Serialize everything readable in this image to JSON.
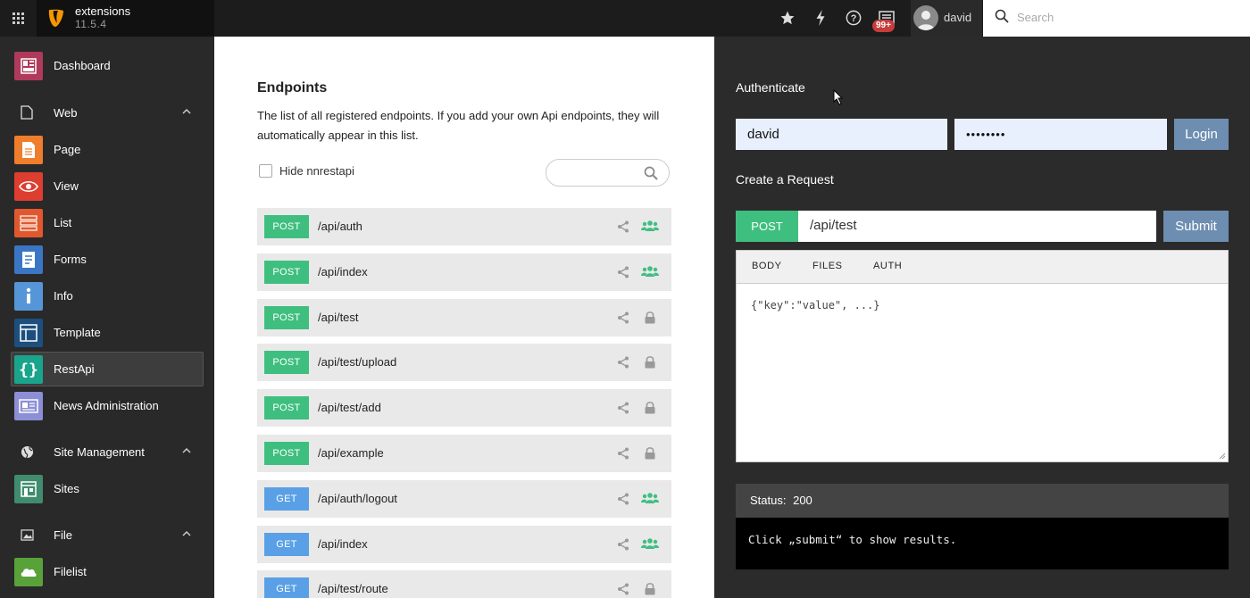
{
  "topbar": {
    "app_name": "extensions",
    "version": "11.5.4",
    "notification_count": "99+",
    "username": "david",
    "search_placeholder": "Search"
  },
  "sidebar": {
    "items": [
      {
        "label": "Dashboard",
        "icon": "dashboard-icon",
        "color": "#b03a5b"
      },
      {
        "label": "Web",
        "icon": "document-icon",
        "group": true
      },
      {
        "label": "Page",
        "icon": "page-icon",
        "color": "#f07d2b"
      },
      {
        "label": "View",
        "icon": "eye-icon",
        "color": "#dd3e30"
      },
      {
        "label": "List",
        "icon": "list-icon",
        "color": "#e2582e"
      },
      {
        "label": "Forms",
        "icon": "forms-icon",
        "color": "#3b76c4"
      },
      {
        "label": "Info",
        "icon": "info-icon",
        "color": "#5696d8"
      },
      {
        "label": "Template",
        "icon": "template-icon",
        "color": "#1c4f7e"
      },
      {
        "label": "RestApi",
        "icon": "braces-icon",
        "color": "#1aa48c"
      },
      {
        "label": "News Administration",
        "icon": "news-icon",
        "color": "#8c8fd6"
      },
      {
        "label": "Site Management",
        "icon": "globe-icon",
        "group": true
      },
      {
        "label": "Sites",
        "icon": "sites-icon",
        "color": "#3f8c6f"
      },
      {
        "label": "File",
        "icon": "image-icon",
        "group": true
      },
      {
        "label": "Filelist",
        "icon": "filelist-icon",
        "color": "#59a23a"
      }
    ]
  },
  "endpoints_panel": {
    "title": "Endpoints",
    "description": "The list of all registered endpoints. If you add your own Api endpoints, they will automatically appear in this list.",
    "hide_label": "Hide nnrestapi",
    "endpoints": [
      {
        "method": "POST",
        "path": "/api/auth",
        "access": "users-icon"
      },
      {
        "method": "POST",
        "path": "/api/index",
        "access": "users-icon"
      },
      {
        "method": "POST",
        "path": "/api/test",
        "access": "lock-icon"
      },
      {
        "method": "POST",
        "path": "/api/test/upload",
        "access": "lock-icon"
      },
      {
        "method": "POST",
        "path": "/api/test/add",
        "access": "lock-icon"
      },
      {
        "method": "POST",
        "path": "/api/example",
        "access": "lock-icon"
      },
      {
        "method": "GET",
        "path": "/api/auth/logout",
        "access": "users-icon"
      },
      {
        "method": "GET",
        "path": "/api/index",
        "access": "users-icon"
      },
      {
        "method": "GET",
        "path": "/api/test/route",
        "access": "lock-icon"
      }
    ]
  },
  "request_panel": {
    "authenticate_title": "Authenticate",
    "username_value": "david",
    "password_value": "••••••••",
    "login_label": "Login",
    "create_request_title": "Create a Request",
    "method": "POST",
    "url": "/api/test",
    "submit_label": "Submit",
    "tabs": [
      "BODY",
      "FILES",
      "AUTH"
    ],
    "body_placeholder": "{\"key\":\"value\", ...}",
    "status_label": "Status:",
    "status_code": "200",
    "result_text": "Click „submit“ to show results."
  },
  "colors": {
    "post": "#3fbf7f",
    "get": "#5aa0e6",
    "button": "#6d8eb1",
    "badge": "#c83c3c"
  }
}
